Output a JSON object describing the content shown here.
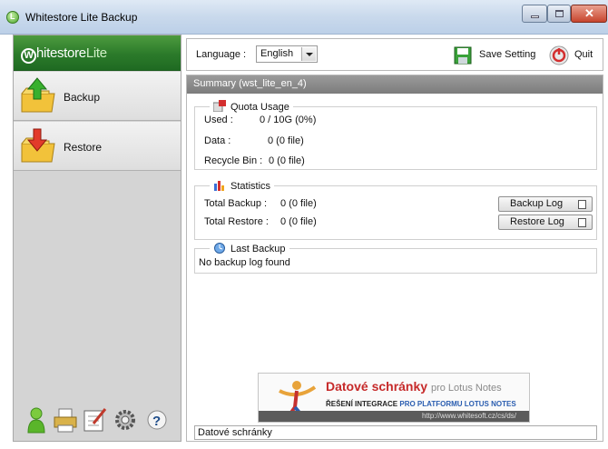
{
  "window": {
    "title": "Whitestore Lite Backup"
  },
  "sidebar": {
    "brand": {
      "mark": "W",
      "name": "hitestore",
      "suffix": "Lite"
    },
    "items": [
      {
        "label": "Backup",
        "icon": "backup-folder-icon"
      },
      {
        "label": "Restore",
        "icon": "restore-folder-icon"
      }
    ],
    "tools": [
      "user-icon",
      "printer-icon",
      "notes-icon",
      "settings-gear-icon",
      "help-icon"
    ]
  },
  "toolbar": {
    "language_label": "Language :",
    "language_value": "English",
    "save_label": "Save Setting",
    "quit_label": "Quit"
  },
  "summary": {
    "header": "Summary (wst_lite_en_4)",
    "quota": {
      "title": "Quota Usage",
      "used_label": "Used :",
      "used_value": "0 / 10G (0%)",
      "data_label": "Data :",
      "data_value": "0  (0 file)",
      "recycle_label": "Recycle Bin :",
      "recycle_value": "0  (0 file)"
    },
    "statistics": {
      "title": "Statistics",
      "total_backup_label": "Total Backup :",
      "total_backup_value": "0  (0 file)",
      "total_restore_label": "Total Restore :",
      "total_restore_value": "0  (0 file)",
      "backup_log_button": "Backup Log",
      "restore_log_button": "Restore Log"
    },
    "last_backup": {
      "title": "Last Backup",
      "message": "No backup log found"
    }
  },
  "ad": {
    "title": "Datové schránky",
    "title_suffix": "pro Lotus Notes",
    "line_a": "ŘEŠENÍ INTEGRACE",
    "line_b": "PRO PLATFORMU LOTUS NOTES",
    "url": "http://www.whitesoft.cz/cs/ds/"
  },
  "status": {
    "text": "Datové schránky"
  },
  "colors": {
    "brand_green": "#2b7a2a",
    "summary_gray": "#8a8a8a",
    "ad_red": "#c62a2a"
  }
}
